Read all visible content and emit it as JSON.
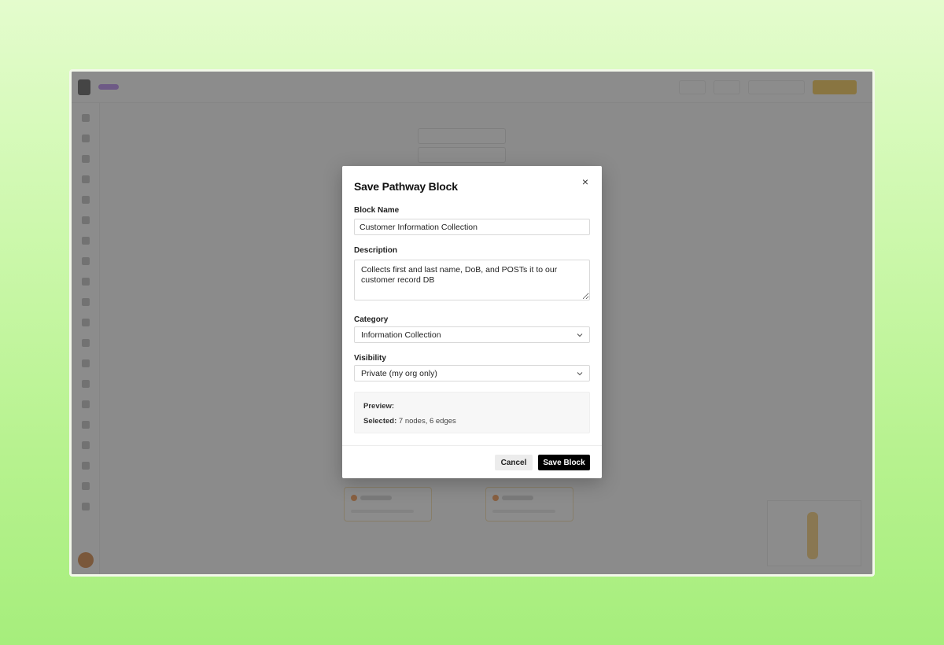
{
  "modal": {
    "title": "Save Pathway Block",
    "block_name_label": "Block Name",
    "block_name_value": "Customer Information Collection",
    "description_label": "Description",
    "description_value": "Collects first and last name, DoB, and POSTs it to our customer record DB",
    "category_label": "Category",
    "category_value": "Information Collection",
    "visibility_label": "Visibility",
    "visibility_value": "Private (my org only)",
    "preview_heading": "Preview:",
    "preview_selected_label": "Selected:",
    "preview_selected_value": "7 nodes, 6 edges",
    "cancel_label": "Cancel",
    "save_label": "Save Block",
    "close_glyph": "×"
  },
  "icons": {
    "close": "close-icon",
    "select_arrow": "chevron-down-icon"
  },
  "colors": {
    "primary_button": "#000000",
    "secondary_button": "#ececec",
    "background_gradient_top": "#e4fccd",
    "background_gradient_bottom": "#a6ee7c"
  }
}
